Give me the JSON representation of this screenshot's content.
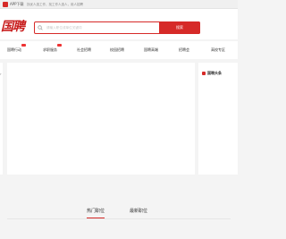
{
  "topbar": {
    "app_label": "APP下载",
    "slogan": "找优人选工作，找工作人选人，用人招聘"
  },
  "header": {
    "logo_text": "国聘",
    "search_placeholder": "请输入职位或单位关键词",
    "search_button": "搜索"
  },
  "nav": {
    "items": [
      {
        "label": "国聘行动",
        "badge": true
      },
      {
        "label": "求职服务",
        "badge": true
      },
      {
        "label": "社会招聘",
        "badge": false
      },
      {
        "label": "校园招聘",
        "badge": false
      },
      {
        "label": "国聘高端",
        "badge": false
      },
      {
        "label": "招聘会",
        "badge": false
      },
      {
        "label": "高校专区",
        "badge": false
      }
    ]
  },
  "news": {
    "title": "国聘头条"
  },
  "tabs": {
    "items": [
      "热门职位",
      "最新职位"
    ],
    "active_index": 0
  },
  "colors": {
    "accent": "#d62a28"
  }
}
